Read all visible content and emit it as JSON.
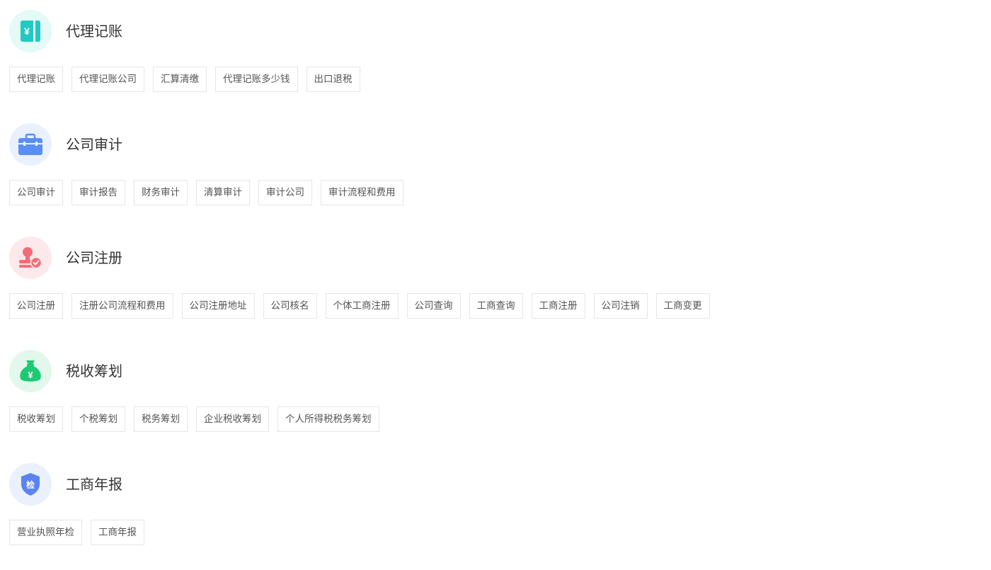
{
  "sections": [
    {
      "title": "代理记账",
      "icon": "ledger-yuan-icon",
      "circle_color": "#e3faf7",
      "accent_color": "#22c9c2",
      "tags": [
        "代理记账",
        "代理记账公司",
        "汇算清缴",
        "代理记账多少钱",
        "出口退税"
      ]
    },
    {
      "title": "公司审计",
      "icon": "briefcase-icon",
      "circle_color": "#eaf1fd",
      "accent_color": "#5b8ff5",
      "tags": [
        "公司审计",
        "审计报告",
        "财务审计",
        "清算审计",
        "审计公司",
        "审计流程和费用"
      ]
    },
    {
      "title": "公司注册",
      "icon": "stamp-check-icon",
      "circle_color": "#fde9eb",
      "accent_color": "#f56c77",
      "tags": [
        "公司注册",
        "注册公司流程和费用",
        "公司注册地址",
        "公司核名",
        "个体工商注册",
        "公司查询",
        "工商查询",
        "工商注册",
        "公司注销",
        "工商变更"
      ]
    },
    {
      "title": "税收筹划",
      "icon": "money-bag-icon",
      "circle_color": "#e2f8ec",
      "accent_color": "#1ec973",
      "tags": [
        "税收筹划",
        "个税筹划",
        "税务筹划",
        "企业税收筹划",
        "个人所得税税务筹划"
      ]
    },
    {
      "title": "工商年报",
      "icon": "shield-inspect-icon",
      "circle_color": "#eaf0fc",
      "accent_color": "#5b84f0",
      "badge_text": "检",
      "tags": [
        "营业执照年检",
        "工商年报"
      ]
    }
  ]
}
